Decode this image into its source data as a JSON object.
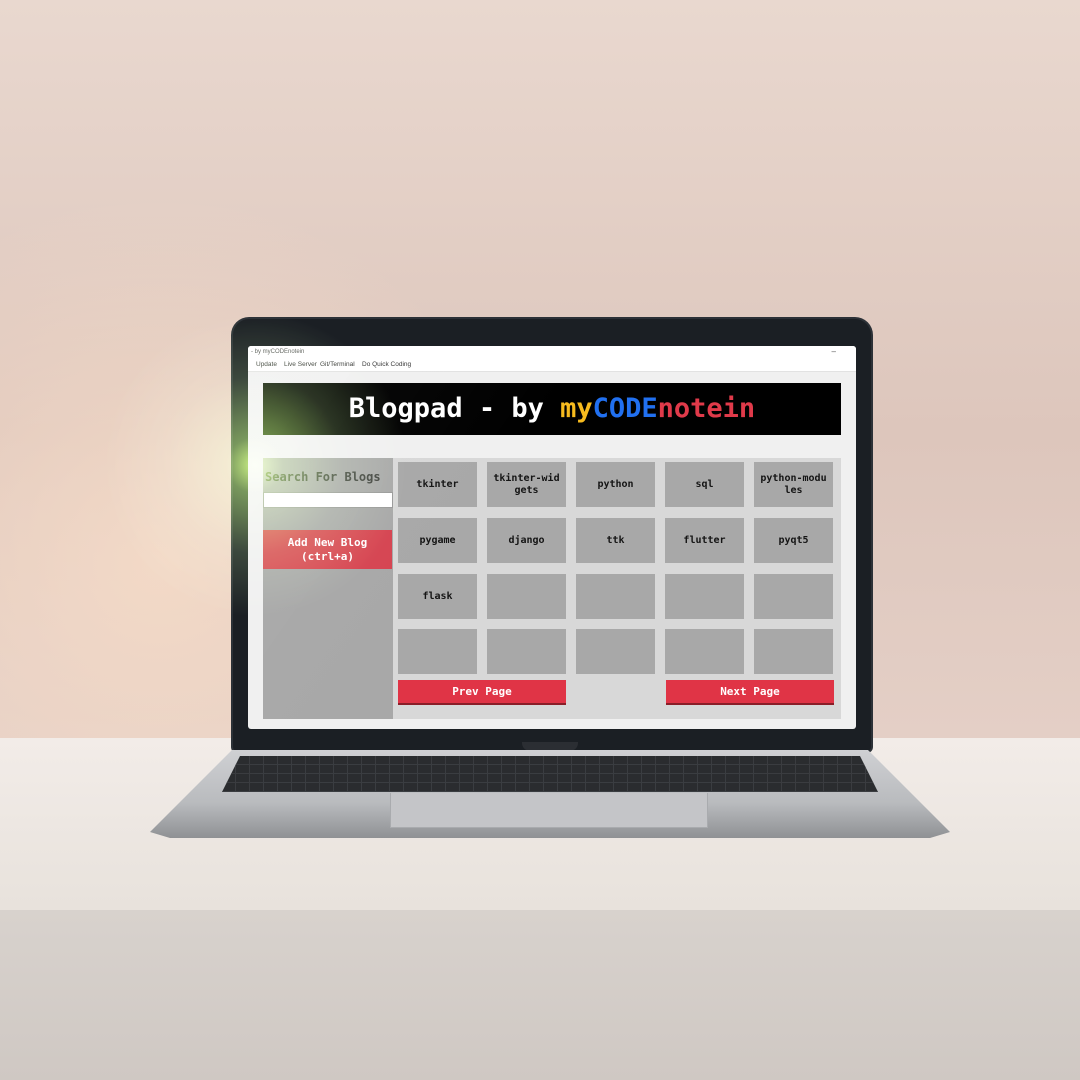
{
  "window": {
    "title": "- by myCODEnotein",
    "minimize_glyph": "–"
  },
  "menu": {
    "items": [
      "Update",
      "Live Server",
      "Git/Terminal",
      "Do Quick Coding"
    ]
  },
  "banner": {
    "prefix": "Blogpad - by ",
    "my": "my",
    "code": "CODE",
    "notein": "notein",
    "colors": {
      "my": "#f7bb1e",
      "code": "#2170f0",
      "notein": "#e03a4a"
    }
  },
  "sidebar": {
    "search_label": "Search For Blogs",
    "search_value": "",
    "add_button_label": "Add New Blog\n(ctrl+a)"
  },
  "tiles": [
    "tkinter",
    "tkinter-widgets",
    "python",
    "sql",
    "python-modules",
    "pygame",
    "django",
    "ttk",
    "flutter",
    "pyqt5",
    "flask",
    "",
    "",
    "",
    "",
    "",
    "",
    "",
    "",
    ""
  ],
  "pagination": {
    "prev_label": "Prev Page",
    "next_label": "Next Page"
  },
  "colors": {
    "accent_red": "#e03446",
    "tile_gray": "#a8a8a8"
  }
}
